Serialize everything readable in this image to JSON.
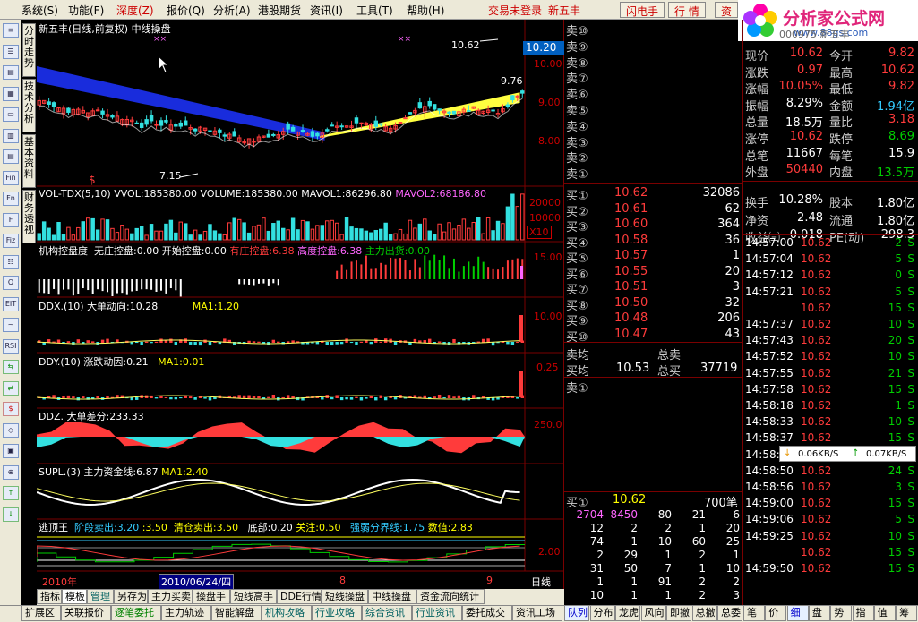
{
  "menu": {
    "items": [
      "系统(S)",
      "功能(F)",
      "深度(Z)",
      "报价(Q)",
      "分析(A)",
      "港股期货",
      "资讯(I)",
      "工具(T)",
      "帮助(H)"
    ],
    "active_index": 2,
    "login_text": "交易未登录",
    "stock_name": "新五丰",
    "buttons": [
      "闪电手",
      "行 情",
      "资"
    ]
  },
  "logo": {
    "title": "分析家公式网",
    "url": "www.88gs.com"
  },
  "left_tools": [
    "≡",
    "☰",
    "▤",
    "▦",
    "▭",
    "▥",
    "▤",
    "Fin",
    "Fn",
    "F",
    "Fiz",
    "☷",
    "Q",
    "EIT",
    "~",
    "RSI",
    "⇆",
    "⇄",
    "$",
    "◇",
    "▣",
    "⊕",
    "↑",
    "↓"
  ],
  "vertical_tabs": [
    "分时走势",
    "技术分析",
    "基本资料",
    "财务透视"
  ],
  "main_chart": {
    "title": "新五丰(日线,前复权)",
    "indicator": "中线操盘",
    "high_label": "10.62",
    "low_label": "7.15",
    "last_label": "9.76",
    "price_box": "10.20",
    "y_labels": [
      "10.00",
      "9.00",
      "8.00"
    ],
    "dollar_mark": "$",
    "x_marks": [
      "××",
      "××"
    ]
  },
  "panels": [
    {
      "title": "VOL-TDX(5,10)",
      "parts": [
        {
          "t": "VVOL:185380.00",
          "c": "#fff"
        },
        {
          "t": "VOLUME:185380.00",
          "c": "#fff"
        },
        {
          "t": "MAVOL1:86296.80",
          "c": "#fff"
        },
        {
          "t": "MAVOL2:68186.80",
          "c": "#ff66ff"
        }
      ],
      "y": [
        "20000",
        "10000"
      ],
      "unit": "X10"
    },
    {
      "title": "机构控盘度",
      "parts": [
        {
          "t": "无庄控盘:0.00",
          "c": "#fff"
        },
        {
          "t": "开始控盘:0.00",
          "c": "#fff"
        },
        {
          "t": "有庄控盘:6.38",
          "c": "#ff3b3b"
        },
        {
          "t": "高度控盘:6.38",
          "c": "#ff66ff"
        },
        {
          "t": "主力出货:0.00",
          "c": "#00d000"
        }
      ],
      "y": [
        "15.00"
      ]
    },
    {
      "title": "DDX.(10)",
      "parts": [
        {
          "t": "大单动向:10.28",
          "c": "#fff"
        },
        {
          "t": "MA1:1.20",
          "c": "#ffff00"
        }
      ],
      "y": [
        "10.00"
      ]
    },
    {
      "title": "DDY.(10)",
      "parts": [
        {
          "t": "涨跌动因:0.21",
          "c": "#fff"
        },
        {
          "t": "MA1:0.01",
          "c": "#ffff00"
        }
      ],
      "y": [
        "0.25"
      ]
    },
    {
      "title": "DDZ.",
      "parts": [
        {
          "t": "大单差分:233.33",
          "c": "#fff"
        }
      ],
      "y": [
        "250.0"
      ]
    },
    {
      "title": "SUPL.(3)",
      "parts": [
        {
          "t": "主力资金线:6.87",
          "c": "#fff"
        },
        {
          "t": "MA1:2.40",
          "c": "#ffff00"
        }
      ],
      "y": []
    },
    {
      "title": "逃顶王",
      "parts": [
        {
          "t": "阶段卖出:3.20",
          "c": "#33ccff"
        },
        {
          "t": ":3.50",
          "c": "#ffff00"
        },
        {
          "t": "清仓卖出:3.50",
          "c": "#ffff00"
        },
        {
          "t": "底部:0.20",
          "c": "#fff"
        },
        {
          "t": "关注:0.50",
          "c": "#ffff00"
        },
        {
          "t": "强弱分界线:1.75",
          "c": "#33ccff"
        },
        {
          "t": "数值:2.83",
          "c": "#ffff00"
        }
      ],
      "y": [
        "2.00"
      ]
    }
  ],
  "xaxis": {
    "labels": [
      "2010年",
      "2010/06/24/四",
      "8",
      "9"
    ],
    "period": "日线"
  },
  "bottom_tabs_left": [
    "指标",
    "模板",
    "管理",
    "另存为",
    "主力买卖",
    "操盘手",
    "短线高手",
    "DDE行情",
    "短线操盘",
    "中线操盘",
    "资金流向统计"
  ],
  "bottom_tabs_active": 1,
  "bottom_row": [
    "扩展区",
    "关联报价",
    "逐笔委托",
    "主力轨迹",
    "智能解盘",
    "机构攻略",
    "行业攻略",
    "综合资讯",
    "行业资讯",
    "委托成交",
    "资讯工场"
  ],
  "right_bottom_tabs": [
    "队列",
    "分布",
    "龙虎",
    "风向",
    "即撤",
    "总撤",
    "总委"
  ],
  "right_bottom_tabs2": [
    "笔",
    "价",
    "细",
    "盘",
    "势",
    "指",
    "值",
    "筹"
  ],
  "sell_orders": [
    "卖⑩",
    "卖⑨",
    "卖⑧",
    "卖⑦",
    "卖⑥",
    "卖⑤",
    "卖④",
    "卖③",
    "卖②",
    "卖①"
  ],
  "buy_orders": [
    {
      "label": "买①",
      "price": "10.62",
      "vol": "32086"
    },
    {
      "label": "买②",
      "price": "10.61",
      "vol": "62"
    },
    {
      "label": "买③",
      "price": "10.60",
      "vol": "364"
    },
    {
      "label": "买④",
      "price": "10.58",
      "vol": "36"
    },
    {
      "label": "买⑤",
      "price": "10.57",
      "vol": "1"
    },
    {
      "label": "买⑥",
      "price": "10.55",
      "vol": "20"
    },
    {
      "label": "买⑦",
      "price": "10.51",
      "vol": "3"
    },
    {
      "label": "买⑧",
      "price": "10.50",
      "vol": "32"
    },
    {
      "label": "买⑨",
      "price": "10.48",
      "vol": "206"
    },
    {
      "label": "买⑩",
      "price": "10.47",
      "vol": "43"
    }
  ],
  "avg": {
    "sell_avg_label": "卖均",
    "total_sell_label": "总卖",
    "buy_avg_label": "买均",
    "buy_avg": "10.53",
    "total_buy_label": "总买",
    "total_buy": "37719",
    "sell1_label": "卖①"
  },
  "queue": {
    "label": "买①",
    "price": "10.62",
    "count": "700笔",
    "rows": [
      [
        "2704",
        "8450",
        "80",
        "21",
        "6"
      ],
      [
        "12",
        "2",
        "2",
        "1",
        "20"
      ],
      [
        "74",
        "1",
        "10",
        "60",
        "25"
      ],
      [
        "2",
        "29",
        "1",
        "2",
        "1"
      ],
      [
        "31",
        "50",
        "7",
        "1",
        "10"
      ],
      [
        "1",
        "1",
        "91",
        "2",
        "2"
      ],
      [
        "10",
        "1",
        "1",
        "2",
        "3"
      ]
    ]
  },
  "quote": {
    "code_label": "000975 新五丰",
    "rows": [
      [
        {
          "t": "现价",
          "c": "l"
        },
        {
          "t": "10.62",
          "c": "red"
        },
        {
          "t": "今开",
          "c": "l"
        },
        {
          "t": "9.82",
          "c": "red"
        }
      ],
      [
        {
          "t": "涨跌",
          "c": "l"
        },
        {
          "t": "0.97",
          "c": "red"
        },
        {
          "t": "最高",
          "c": "l"
        },
        {
          "t": "10.62",
          "c": "red"
        }
      ],
      [
        {
          "t": "涨幅",
          "c": "l"
        },
        {
          "t": "10.05%",
          "c": "red"
        },
        {
          "t": "最低",
          "c": "l"
        },
        {
          "t": "9.82",
          "c": "red"
        }
      ],
      [
        {
          "t": "振幅",
          "c": "l"
        },
        {
          "t": "8.29%",
          "c": "wht"
        },
        {
          "t": "金额",
          "c": "l"
        },
        {
          "t": "1.94亿",
          "c": "cyn"
        }
      ],
      [
        {
          "t": "总量",
          "c": "l"
        },
        {
          "t": "18.5万",
          "c": "wht"
        },
        {
          "t": "量比",
          "c": "l"
        },
        {
          "t": "3.18",
          "c": "red"
        }
      ],
      [
        {
          "t": "涨停",
          "c": "l"
        },
        {
          "t": "10.62",
          "c": "red"
        },
        {
          "t": "跌停",
          "c": "l"
        },
        {
          "t": "8.69",
          "c": "grn"
        }
      ],
      [
        {
          "t": "总笔",
          "c": "l"
        },
        {
          "t": "11667",
          "c": "wht"
        },
        {
          "t": "每笔",
          "c": "l"
        },
        {
          "t": "15.9",
          "c": "wht"
        }
      ],
      [
        {
          "t": "外盘",
          "c": "l"
        },
        {
          "t": "50440",
          "c": "red"
        },
        {
          "t": "内盘",
          "c": "l"
        },
        {
          "t": "13.5万",
          "c": "grn"
        }
      ],
      [
        {
          "t": "换手",
          "c": "l"
        },
        {
          "t": "10.28%",
          "c": "wht"
        },
        {
          "t": "股本",
          "c": "l"
        },
        {
          "t": "1.80亿",
          "c": "wht"
        }
      ],
      [
        {
          "t": "净资",
          "c": "l"
        },
        {
          "t": "2.48",
          "c": "wht"
        },
        {
          "t": "流通",
          "c": "l"
        },
        {
          "t": "1.80亿",
          "c": "wht"
        }
      ],
      [
        {
          "t": "收益㈢",
          "c": "l"
        },
        {
          "t": "0.018",
          "c": "wht"
        },
        {
          "t": "PE(动)",
          "c": "l"
        },
        {
          "t": "298.3",
          "c": "wht"
        }
      ]
    ]
  },
  "ticks": [
    [
      "14:57:00",
      "10.62",
      "2",
      "S"
    ],
    [
      "14:57:04",
      "10.62",
      "5",
      "S"
    ],
    [
      "14:57:12",
      "10.62",
      "0",
      "S"
    ],
    [
      "14:57:21",
      "10.62",
      "5",
      "S"
    ],
    [
      "",
      "10.62",
      "15",
      "S"
    ],
    [
      "14:57:37",
      "10.62",
      "10",
      "S"
    ],
    [
      "14:57:43",
      "10.62",
      "20",
      "S"
    ],
    [
      "14:57:52",
      "10.62",
      "10",
      "S"
    ],
    [
      "14:57:55",
      "10.62",
      "21",
      "S"
    ],
    [
      "14:57:58",
      "10.62",
      "15",
      "S"
    ],
    [
      "14:58:18",
      "10.62",
      "1",
      "S"
    ],
    [
      "14:58:33",
      "10.62",
      "10",
      "S"
    ],
    [
      "14:58:37",
      "10.62",
      "15",
      "S"
    ],
    [
      "14:58:43",
      "10.62",
      "1",
      "S"
    ],
    [
      "14:58:50",
      "10.62",
      "24",
      "S"
    ],
    [
      "14:58:56",
      "10.62",
      "3",
      "S"
    ],
    [
      "14:59:00",
      "10.62",
      "15",
      "S"
    ],
    [
      "14:59:06",
      "10.62",
      "5",
      "S"
    ],
    [
      "14:59:25",
      "10.62",
      "10",
      "S"
    ],
    [
      "",
      "10.62",
      "15",
      "S"
    ],
    [
      "14:59:50",
      "10.62",
      "15",
      "S"
    ]
  ],
  "network": {
    "down": "0.06KB/S",
    "up": "0.07KB/S"
  }
}
